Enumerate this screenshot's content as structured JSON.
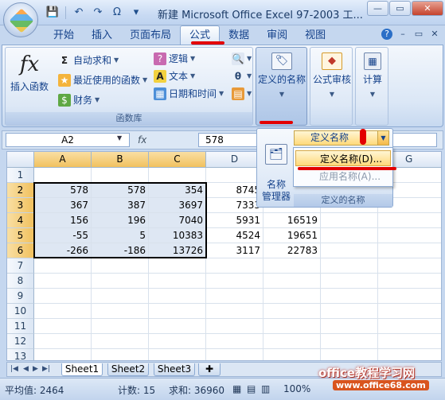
{
  "window": {
    "title": "新建 Microsoft Office Excel 97-2003 工...",
    "minimize": "—",
    "restore": "▭",
    "close": "✕"
  },
  "quick_access": {
    "save": "💾",
    "undo": "↶",
    "redo": "↷",
    "omega": "Ω",
    "more": "▾"
  },
  "tabs": [
    "开始",
    "插入",
    "页面布局",
    "公式",
    "数据",
    "审阅",
    "视图"
  ],
  "active_tab": "公式",
  "ribbon": {
    "insert_function": "插入函数",
    "autosum": "自动求和",
    "recent": "最近使用的函数",
    "finance": "财务",
    "logic": "逻辑",
    "text": "文本",
    "datetime": "日期和时间",
    "function_library": "函数库",
    "defined_names": "定义的名称",
    "formula_auditing": "公式审核",
    "calculation": "计算"
  },
  "define_group": {
    "name_manager": "名称\n管理器",
    "define_name_button": "定义名称",
    "group_label": "定义的名称"
  },
  "dropdown_menu": {
    "define_name": "定义名称(D)...",
    "apply_name": "应用名称(A)..."
  },
  "formula_bar": {
    "name_box": "A2",
    "fx": "fx",
    "formula": "578"
  },
  "grid": {
    "columns": [
      "A",
      "B",
      "C",
      "D",
      "",
      "G"
    ],
    "rows": [
      "1",
      "2",
      "3",
      "4",
      "5",
      "6",
      "7",
      "8",
      "9",
      "10",
      "11",
      "12",
      "13"
    ],
    "cells": [
      [
        "",
        "",
        "",
        "",
        ""
      ],
      [
        "578",
        "578",
        "354",
        "8745",
        ""
      ],
      [
        "367",
        "387",
        "3697",
        "7333",
        ""
      ],
      [
        "156",
        "196",
        "7040",
        "5931",
        "16519"
      ],
      [
        "-55",
        "5",
        "10383",
        "4524",
        "19651"
      ],
      [
        "-266",
        "-186",
        "13726",
        "3117",
        "22783"
      ]
    ]
  },
  "sheets": [
    "Sheet1",
    "Sheet2",
    "Sheet3"
  ],
  "active_sheet": "Sheet1",
  "status": {
    "average": "平均值: 2464",
    "count": "计数: 15",
    "sum": "求和: 36960",
    "zoom": "100%"
  },
  "watermark": {
    "site_cn": "office教程学习网",
    "site_url": "www.office68.com"
  }
}
